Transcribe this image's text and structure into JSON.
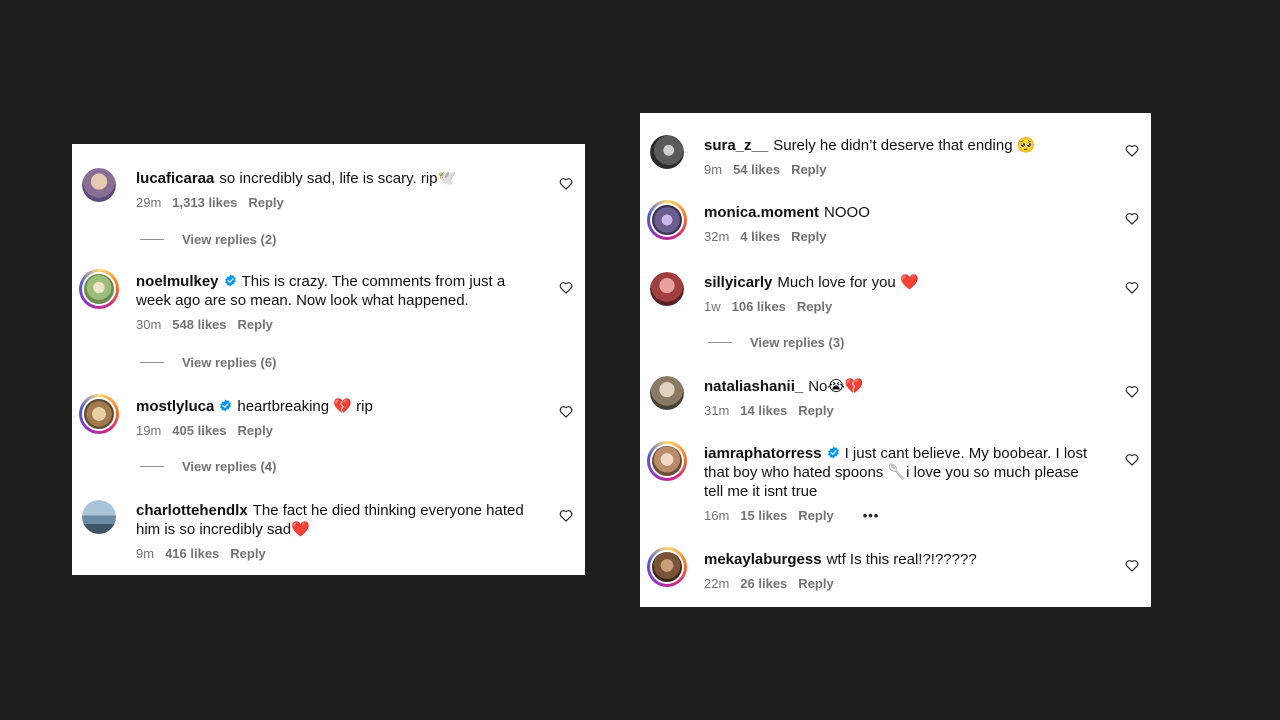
{
  "left_panel": {
    "comments": [
      {
        "username": "lucaficaraa",
        "verified": false,
        "text": "so incredibly sad, life is scary. rip🕊️",
        "time": "29m",
        "likes": "1,313 likes",
        "reply": "Reply",
        "view_replies": "View replies (2)"
      },
      {
        "username": "noelmulkey",
        "verified": true,
        "text": "This is crazy. The comments from just a week ago are so mean. Now look what happened.",
        "time": "30m",
        "likes": "548 likes",
        "reply": "Reply",
        "view_replies": "View replies (6)"
      },
      {
        "username": "mostlyluca",
        "verified": true,
        "text": "heartbreaking 💔 rip",
        "time": "19m",
        "likes": "405 likes",
        "reply": "Reply",
        "view_replies": "View replies (4)"
      },
      {
        "username": "charlottehendlx",
        "verified": false,
        "text": "The fact he died thinking everyone hated him is so incredibly sad❤️",
        "time": "9m",
        "likes": "416 likes",
        "reply": "Reply"
      }
    ]
  },
  "right_panel": {
    "comments": [
      {
        "username": "sura_z__",
        "verified": false,
        "text": "Surely he didn’t deserve that ending 🥺",
        "time": "9m",
        "likes": "54 likes",
        "reply": "Reply"
      },
      {
        "username": "monica.moment",
        "verified": false,
        "text": "NOOO",
        "time": "32m",
        "likes": "4 likes",
        "reply": "Reply"
      },
      {
        "username": "sillyicarly",
        "verified": false,
        "text": "Much love for you ❤️",
        "time": "1w",
        "likes": "106 likes",
        "reply": "Reply",
        "view_replies": "View replies (3)"
      },
      {
        "username": "nataliashanii_",
        "verified": false,
        "text": "No😭💔",
        "time": "31m",
        "likes": "14 likes",
        "reply": "Reply"
      },
      {
        "username": "iamraphatorress",
        "verified": true,
        "text": "I just cant believe. My boobear. I lost that boy who hated spoons 🥄i love you so much please tell me it isnt true",
        "time": "16m",
        "likes": "15 likes",
        "reply": "Reply",
        "more": "•••"
      },
      {
        "username": "mekaylaburgess",
        "verified": false,
        "text": "wtf Is this real!?!?????",
        "time": "22m",
        "likes": "26 likes",
        "reply": "Reply"
      }
    ]
  },
  "colors": {
    "background": "#1e1e1e",
    "panel": "#ffffff",
    "verified": "#0095f6",
    "meta_text": "#737373"
  },
  "icons": {
    "like": "heart-outline-icon",
    "verified": "verified-badge-icon"
  }
}
